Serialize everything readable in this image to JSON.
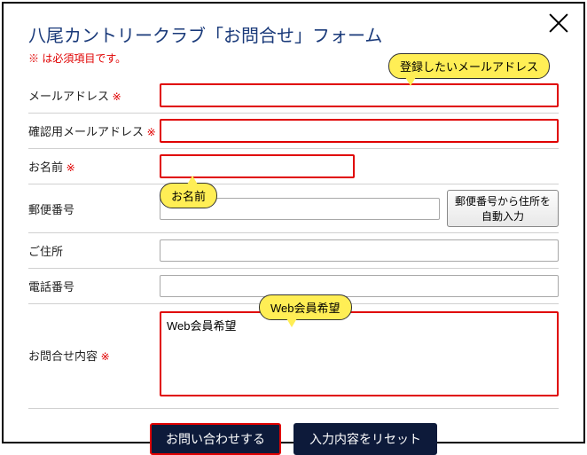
{
  "title": "八尾カントリークラブ「お問合せ」フォーム",
  "required_note": "※ は必須項目です。",
  "req_mark": "※",
  "fields": {
    "email": {
      "label": "メールアドレス"
    },
    "email_confirm": {
      "label": "確認用メールアドレス"
    },
    "name": {
      "label": "お名前"
    },
    "zip": {
      "label": "郵便番号",
      "auto_btn": "郵便番号から住所を自動入力"
    },
    "address": {
      "label": "ご住所"
    },
    "phone": {
      "label": "電話番号"
    },
    "content": {
      "label": "お問合せ内容",
      "value": "Web会員希望"
    }
  },
  "callouts": {
    "email": "登録したいメールアドレス",
    "name": "お名前",
    "content": "Web会員希望"
  },
  "actions": {
    "submit": "お問い合わせする",
    "reset": "入力内容をリセット"
  }
}
